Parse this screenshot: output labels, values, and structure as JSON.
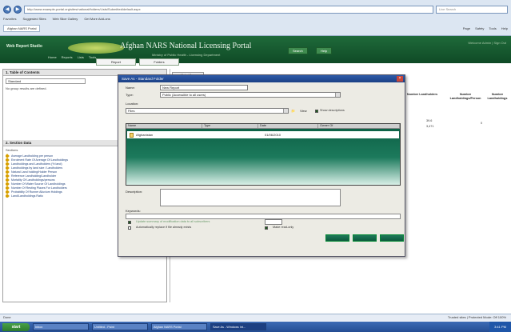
{
  "browser": {
    "address": "http://www.example-portal.org/sites/national/folders/Lists/Submitted/default.aspx",
    "search_placeholder": "Live Search",
    "favorites": [
      "Favorites",
      "Suggested Sites",
      "Web Slice Gallery",
      "Get More Add-ons"
    ],
    "tab": "Afghan NARS Portal",
    "commands": [
      "Page",
      "Safety",
      "Tools",
      "Help"
    ]
  },
  "portal": {
    "brand": "Web Report Studio",
    "title": "Afghan NARS National Licensing Portal",
    "subtitle": "Ministry of Public Health - Licensing Department",
    "buttons": [
      "Search",
      "Help"
    ],
    "right_links": "Welcome Admin | Sign Out",
    "nav": [
      "Home",
      "Reports",
      "Lists",
      "Tools"
    ],
    "page_tabs": [
      "Report",
      "Folders"
    ]
  },
  "left_top": {
    "header": "1. Table of Contents",
    "select_value": "Standard",
    "note": "No group results are defined."
  },
  "left_bottom": {
    "header": "2. Section Data",
    "label": "Sections",
    "items": [
      "Average Landholding per person",
      "Enrolment Rate Of Average Of Landholdings",
      "Landholdings and Landholders (% land)",
      "Landholdings by land size / Landholders",
      "Natural Land holding/Holder Person",
      "Reference Landholding/Landholder",
      "Mortality Of Landholdings/persons",
      "Number Of Water Source Of Landholdings",
      "Number Of Resting Places For Landholders",
      "Probability Of Runner Alluvium Holdings",
      "Land/Landholdings Ratio"
    ]
  },
  "main": {
    "tab": "Meta View",
    "columns": [
      "Number Landholders",
      "Number Landholdings/Person",
      "Number Landholdings"
    ],
    "values": [
      "39.6",
      "3,471",
      "0"
    ]
  },
  "dialog": {
    "title": "Save As - Standard Folder",
    "name_label": "Name:",
    "name_value": "New Report",
    "type_label": "Type:",
    "type_value": "Public (Accessible to all users)",
    "location_label": "Location:",
    "location_value": "Files",
    "view_label": "View",
    "show_label": "Show descriptions",
    "list_headers": [
      "Name",
      "Type",
      "Date",
      "Owner Of"
    ],
    "file_name": "Afghanistan",
    "file_date": "01/06/2010",
    "description_label": "Description:",
    "keywords_label": "Keywords:",
    "checkbox1": "Update summary of modification data to all subscribers",
    "checkbox2": "Automatically replace if file already exists",
    "checkbox3": "Make read-only",
    "spin_value": ""
  },
  "status": {
    "left": "Done",
    "right": "Trusted sites | Protected Mode: Off   100%"
  },
  "taskbar": {
    "start": "start",
    "tasks": [
      "Inbox",
      "Untitled - Paint",
      "Afghan NARS Portal",
      "Save As - Windows Int..."
    ],
    "clock": "3:41 PM"
  },
  "colors": {
    "portal_green": "#1f6a3a",
    "dialog_title": "#2e5aa8",
    "list_gradient_top": "#0b5d43"
  }
}
